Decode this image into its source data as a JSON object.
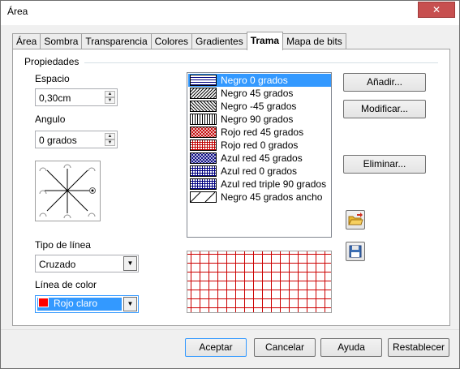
{
  "window": {
    "title": "Área",
    "close_glyph": "✕"
  },
  "tabs": [
    {
      "label": "Área"
    },
    {
      "label": "Sombra"
    },
    {
      "label": "Transparencia"
    },
    {
      "label": "Colores"
    },
    {
      "label": "Gradientes"
    },
    {
      "label": "Trama",
      "active": true
    },
    {
      "label": "Mapa de bits"
    }
  ],
  "properties": {
    "group_label": "Propiedades",
    "spacing_label": "Espacio",
    "spacing_value": "0,30cm",
    "angle_label": "Angulo",
    "angle_value": "0 grados",
    "line_type_label": "Tipo de línea",
    "line_type_value": "Cruzado",
    "line_color_label": "Línea de color",
    "line_color_value": "Rojo claro",
    "line_color_hex": "#ff0000"
  },
  "hatch_list": {
    "items": [
      {
        "name": "Negro 0 grados",
        "pattern": "h0",
        "color": "#000080",
        "selected": true
      },
      {
        "name": "Negro 45 grados",
        "pattern": "d45",
        "color": "#000000"
      },
      {
        "name": "Negro -45 grados",
        "pattern": "dm45",
        "color": "#000000"
      },
      {
        "name": "Negro 90 grados",
        "pattern": "v90",
        "color": "#000000"
      },
      {
        "name": "Rojo red 45 grados",
        "pattern": "x45",
        "color": "#c00000"
      },
      {
        "name": "Rojo red 0 grados",
        "pattern": "grid",
        "color": "#c00000"
      },
      {
        "name": "Azul red 45 grados",
        "pattern": "x45",
        "color": "#000080"
      },
      {
        "name": "Azul red 0 grados",
        "pattern": "grid",
        "color": "#000080"
      },
      {
        "name": "Azul red triple 90 grados",
        "pattern": "grid",
        "color": "#000080"
      },
      {
        "name": "Negro 45 grados ancho",
        "pattern": "wide45",
        "color": "#000000"
      }
    ]
  },
  "buttons": {
    "add": "Añadir...",
    "modify": "Modificar...",
    "delete": "Eliminar...",
    "ok": "Aceptar",
    "cancel": "Cancelar",
    "help": "Ayuda",
    "reset": "Restablecer"
  },
  "icons": {
    "load": "open-folder-icon",
    "save": "floppy-save-icon"
  },
  "colors": {
    "accent": "#3399ff",
    "hatch_red": "#cc0000"
  }
}
